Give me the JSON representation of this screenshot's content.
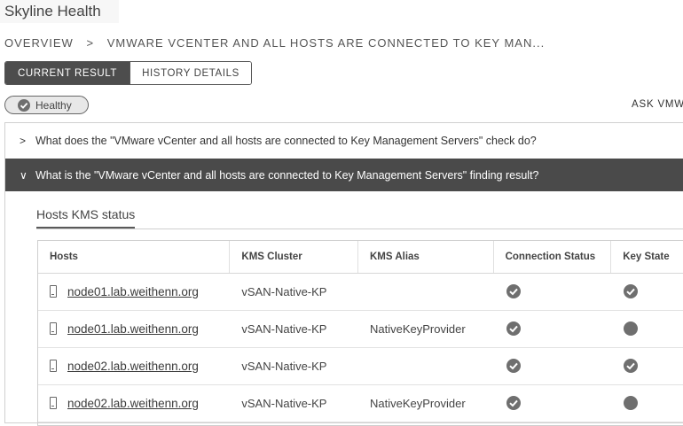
{
  "app": {
    "title": "Skyline Health"
  },
  "breadcrumb": {
    "root": "OVERVIEW",
    "separator": ">",
    "current": "VMWARE VCENTER AND ALL HOSTS ARE CONNECTED TO KEY MAN..."
  },
  "tabs": [
    {
      "label": "CURRENT RESULT",
      "active": true
    },
    {
      "label": "HISTORY DETAILS",
      "active": false
    }
  ],
  "status": {
    "label": "Healthy",
    "icon": "check-circle-icon"
  },
  "ask_link": "ASK VMWA",
  "accordion": [
    {
      "chevron": ">",
      "label": "What does the \"VMware vCenter and all hosts are connected to Key Management Servers\" check do?",
      "expanded": false
    },
    {
      "chevron": "∨",
      "label": "What is the \"VMware vCenter and all hosts are connected to Key Management Servers\" finding result?",
      "expanded": true
    }
  ],
  "subtab": {
    "label": "Hosts KMS status"
  },
  "table": {
    "columns": [
      "Hosts",
      "KMS Cluster",
      "KMS Alias",
      "Connection Status",
      "Key State"
    ],
    "rows": [
      {
        "host": "node01.lab.weithenn.org",
        "kms_cluster": "vSAN-Native-KP",
        "kms_alias": "",
        "connection_status": "ok",
        "key_state": "ok"
      },
      {
        "host": "node01.lab.weithenn.org",
        "kms_cluster": "vSAN-Native-KP",
        "kms_alias": "NativeKeyProvider",
        "connection_status": "ok",
        "key_state": "neutral"
      },
      {
        "host": "node02.lab.weithenn.org",
        "kms_cluster": "vSAN-Native-KP",
        "kms_alias": "",
        "connection_status": "ok",
        "key_state": "ok"
      },
      {
        "host": "node02.lab.weithenn.org",
        "kms_cluster": "vSAN-Native-KP",
        "kms_alias": "NativeKeyProvider",
        "connection_status": "ok",
        "key_state": "neutral"
      }
    ]
  },
  "colors": {
    "dark_header": "#4a4a4a",
    "status_gray": "#6f6f6f"
  }
}
